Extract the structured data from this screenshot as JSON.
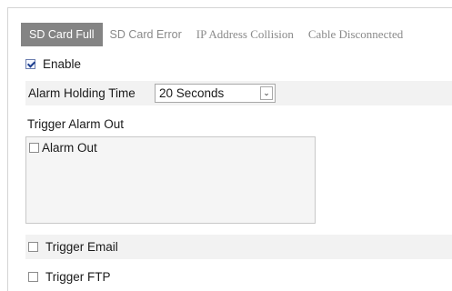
{
  "tabs": [
    {
      "label": "SD Card Full",
      "active": true
    },
    {
      "label": "SD Card Error",
      "active": false
    },
    {
      "label": "IP Address Collision",
      "active": false
    },
    {
      "label": "Cable Disconnected",
      "active": false
    }
  ],
  "enable": {
    "label": "Enable",
    "checked": true
  },
  "alarm_holding_time": {
    "label": "Alarm Holding Time",
    "selected": "20 Seconds"
  },
  "trigger_alarm_out": {
    "label": "Trigger Alarm Out",
    "items": [
      {
        "label": "Alarm Out",
        "checked": false
      }
    ]
  },
  "trigger_email": {
    "label": "Trigger Email",
    "checked": false
  },
  "trigger_ftp": {
    "label": "Trigger FTP",
    "checked": false
  },
  "colors": {
    "active_tab_bg": "#848484",
    "band_bg": "#f2f2f2",
    "inactive_tab_text": "#8a8a8a"
  }
}
